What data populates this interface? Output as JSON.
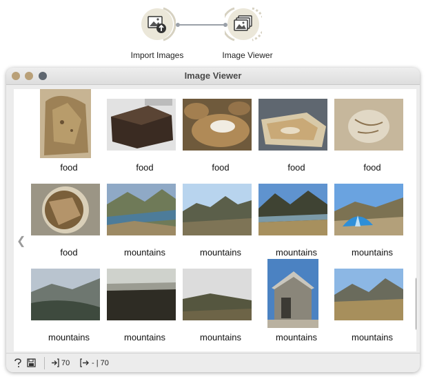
{
  "workflow": {
    "nodes": [
      {
        "label": "Import Images",
        "icon": "import-images-icon"
      },
      {
        "label": "Image Viewer",
        "icon": "image-viewer-icon"
      }
    ]
  },
  "window": {
    "title": "Image Viewer",
    "traffic_lights": [
      "#b9a078",
      "#b9a078",
      "#5f6770"
    ]
  },
  "gallery": {
    "items": [
      {
        "label": "food"
      },
      {
        "label": "food"
      },
      {
        "label": "food"
      },
      {
        "label": "food"
      },
      {
        "label": "food"
      },
      {
        "label": "food"
      },
      {
        "label": "mountains"
      },
      {
        "label": "mountains"
      },
      {
        "label": "mountains"
      },
      {
        "label": "mountains"
      },
      {
        "label": "mountains"
      },
      {
        "label": "mountains"
      },
      {
        "label": "mountains"
      },
      {
        "label": "mountains"
      },
      {
        "label": "mountains"
      }
    ]
  },
  "status": {
    "input_count": "70",
    "output_count": "- | 70"
  }
}
